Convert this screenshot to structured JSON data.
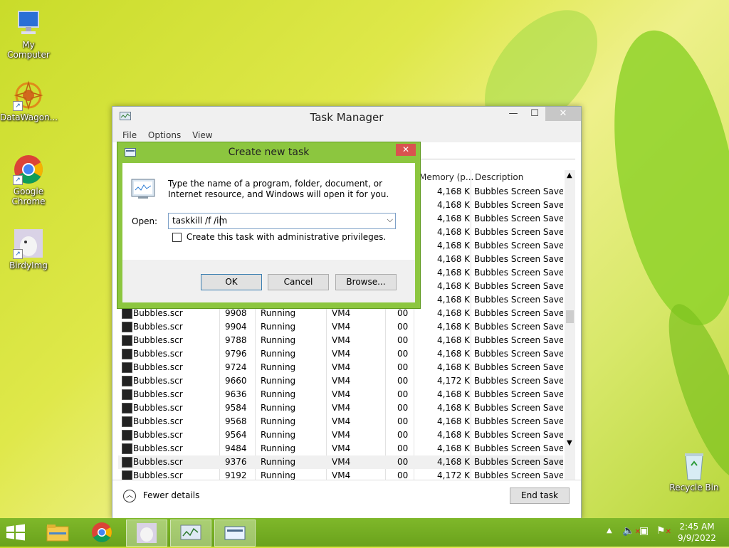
{
  "desktop": {
    "icons": [
      {
        "label": "My Computer",
        "icon": "computer-icon"
      },
      {
        "label": "DataWagon...",
        "icon": "datawagon-icon"
      },
      {
        "label": "Google Chrome",
        "icon": "chrome-icon"
      },
      {
        "label": "BirdyImg",
        "icon": "image-icon"
      },
      {
        "label": "Recycle Bin",
        "icon": "recycle-bin-icon"
      }
    ]
  },
  "task_manager": {
    "title": "Task Manager",
    "menu": [
      "File",
      "Options",
      "View"
    ],
    "columns": {
      "memory": "Memory (p...",
      "description": "Description"
    },
    "top_rows": [
      {
        "memory": "4,168 K",
        "description": "Bubbles Screen Saver"
      },
      {
        "memory": "4,168 K",
        "description": "Bubbles Screen Saver"
      },
      {
        "memory": "4,168 K",
        "description": "Bubbles Screen Saver"
      },
      {
        "memory": "4,168 K",
        "description": "Bubbles Screen Saver"
      },
      {
        "memory": "4,168 K",
        "description": "Bubbles Screen Saver"
      },
      {
        "memory": "4,168 K",
        "description": "Bubbles Screen Saver"
      },
      {
        "memory": "4,168 K",
        "description": "Bubbles Screen Saver"
      },
      {
        "memory": "4,168 K",
        "description": "Bubbles Screen Saver"
      },
      {
        "memory": "4,168 K",
        "description": "Bubbles Screen Saver"
      }
    ],
    "rows": [
      {
        "name": "Bubbles.scr",
        "pid": "9908",
        "status": "Running",
        "user": "VM4",
        "cpu": "00",
        "memory": "4,168 K",
        "description": "Bubbles Screen Saver"
      },
      {
        "name": "Bubbles.scr",
        "pid": "9904",
        "status": "Running",
        "user": "VM4",
        "cpu": "00",
        "memory": "4,168 K",
        "description": "Bubbles Screen Saver"
      },
      {
        "name": "Bubbles.scr",
        "pid": "9788",
        "status": "Running",
        "user": "VM4",
        "cpu": "00",
        "memory": "4,168 K",
        "description": "Bubbles Screen Saver"
      },
      {
        "name": "Bubbles.scr",
        "pid": "9796",
        "status": "Running",
        "user": "VM4",
        "cpu": "00",
        "memory": "4,168 K",
        "description": "Bubbles Screen Saver"
      },
      {
        "name": "Bubbles.scr",
        "pid": "9724",
        "status": "Running",
        "user": "VM4",
        "cpu": "00",
        "memory": "4,168 K",
        "description": "Bubbles Screen Saver"
      },
      {
        "name": "Bubbles.scr",
        "pid": "9660",
        "status": "Running",
        "user": "VM4",
        "cpu": "00",
        "memory": "4,172 K",
        "description": "Bubbles Screen Saver"
      },
      {
        "name": "Bubbles.scr",
        "pid": "9636",
        "status": "Running",
        "user": "VM4",
        "cpu": "00",
        "memory": "4,168 K",
        "description": "Bubbles Screen Saver"
      },
      {
        "name": "Bubbles.scr",
        "pid": "9584",
        "status": "Running",
        "user": "VM4",
        "cpu": "00",
        "memory": "4,168 K",
        "description": "Bubbles Screen Saver"
      },
      {
        "name": "Bubbles.scr",
        "pid": "9568",
        "status": "Running",
        "user": "VM4",
        "cpu": "00",
        "memory": "4,168 K",
        "description": "Bubbles Screen Saver"
      },
      {
        "name": "Bubbles.scr",
        "pid": "9564",
        "status": "Running",
        "user": "VM4",
        "cpu": "00",
        "memory": "4,168 K",
        "description": "Bubbles Screen Saver"
      },
      {
        "name": "Bubbles.scr",
        "pid": "9484",
        "status": "Running",
        "user": "VM4",
        "cpu": "00",
        "memory": "4,168 K",
        "description": "Bubbles Screen Saver"
      },
      {
        "name": "Bubbles.scr",
        "pid": "9376",
        "status": "Running",
        "user": "VM4",
        "cpu": "00",
        "memory": "4,168 K",
        "description": "Bubbles Screen Saver",
        "selected": true
      },
      {
        "name": "Bubbles.scr",
        "pid": "9192",
        "status": "Running",
        "user": "VM4",
        "cpu": "00",
        "memory": "4,172 K",
        "description": "Bubbles Screen Saver"
      }
    ],
    "fewer_details": "Fewer details",
    "end_task": "End task"
  },
  "run_dialog": {
    "title": "Create new task",
    "description": "Type the name of a program, folder, document, or Internet resource, and Windows will open it for you.",
    "open_label": "Open:",
    "open_value": "taskkill /f /im ",
    "admin_checkbox_label": "Create this task with administrative privileges.",
    "admin_checked": false,
    "ok": "OK",
    "cancel": "Cancel",
    "browse": "Browse..."
  },
  "taskbar": {
    "time": "2:45 AM",
    "date": "9/9/2022"
  },
  "colors": {
    "accent": "#8cc63f",
    "taskbar": "#6aa21c"
  }
}
